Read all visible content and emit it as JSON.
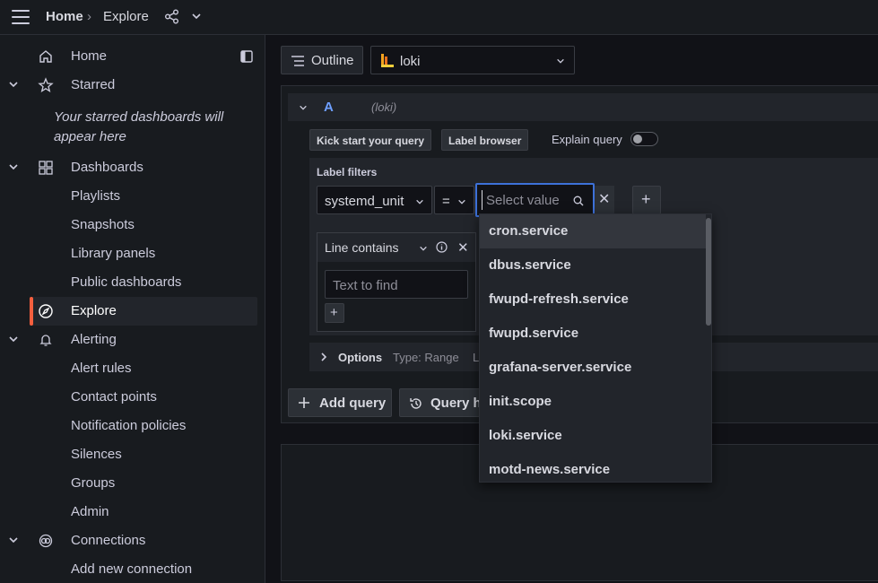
{
  "topbar": {
    "home": "Home",
    "separator": "›",
    "current": "Explore"
  },
  "sidebar": {
    "starred_empty": "Your starred dashboards will appear here",
    "items": [
      {
        "label": "Home"
      },
      {
        "label": "Starred"
      },
      {
        "label": "Dashboards"
      },
      {
        "label": "Playlists"
      },
      {
        "label": "Snapshots"
      },
      {
        "label": "Library panels"
      },
      {
        "label": "Public dashboards"
      },
      {
        "label": "Explore"
      },
      {
        "label": "Alerting"
      },
      {
        "label": "Alert rules"
      },
      {
        "label": "Contact points"
      },
      {
        "label": "Notification policies"
      },
      {
        "label": "Silences"
      },
      {
        "label": "Groups"
      },
      {
        "label": "Admin"
      },
      {
        "label": "Connections"
      },
      {
        "label": "Add new connection"
      }
    ]
  },
  "toolbar": {
    "outline_label": "Outline",
    "datasource": "loki"
  },
  "query": {
    "ref_id": "A",
    "datasource_note": "(loki)",
    "kick_start": "Kick start your query",
    "label_browser": "Label browser",
    "explain": "Explain query",
    "label_filters_title": "Label filters",
    "label_key": "systemd_unit",
    "operator": "=",
    "value_placeholder": "Select value",
    "line_contains": "Line contains",
    "text_placeholder": "Text to find",
    "options_label": "Options",
    "options_type": "Type: Range",
    "options_more": "L"
  },
  "actions": {
    "add_query": "Add query",
    "query_history": "Query h"
  },
  "dropdown": {
    "options": [
      "cron.service",
      "dbus.service",
      "fwupd-refresh.service",
      "fwupd.service",
      "grafana-server.service",
      "init.scope",
      "loki.service",
      "motd-news.service"
    ]
  },
  "colors": {
    "accent": "#3d71d9",
    "active_marker": "#f55f3e",
    "ref_id": "#6e9fff"
  }
}
